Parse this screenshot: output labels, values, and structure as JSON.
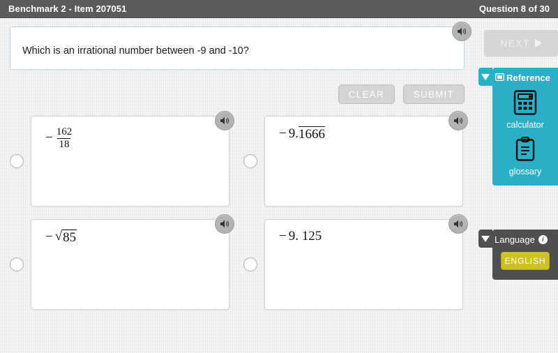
{
  "header": {
    "title": "Benchmark 2 - Item 207051",
    "question_counter": "Question 8 of 30"
  },
  "stem": {
    "text": "Which is an irrational number between -9 and -10?",
    "speaker_icon": "speaker-icon"
  },
  "actions": {
    "clear_label": "CLEAR",
    "submit_label": "SUBMIT"
  },
  "options": [
    {
      "id": "option-a",
      "kind": "fraction",
      "sign": "−",
      "numerator": "162",
      "denominator": "18",
      "speaker_icon": "speaker-icon",
      "selected": false
    },
    {
      "id": "option-b",
      "kind": "repeating-decimal",
      "sign": "−",
      "whole": "9.",
      "repeating": "1666",
      "speaker_icon": "speaker-icon",
      "selected": false
    },
    {
      "id": "option-c",
      "kind": "radical",
      "sign": "−",
      "radical_symbol": "√",
      "radicand": "85",
      "speaker_icon": "speaker-icon",
      "selected": false
    },
    {
      "id": "option-d",
      "kind": "decimal",
      "sign": "−",
      "value": "9. 125",
      "speaker_icon": "speaker-icon",
      "selected": false
    }
  ],
  "rail": {
    "next_label": "NEXT",
    "next_icon": "play-triangle-icon",
    "reference": {
      "title": "Reference",
      "header_icon": "reference-card-icon",
      "collapse_icon": "caret-down-icon",
      "tools": [
        {
          "label": "calculator",
          "icon": "calculator-icon"
        },
        {
          "label": "glossary",
          "icon": "clipboard-icon"
        }
      ]
    },
    "language": {
      "title": "Language",
      "info_icon": "info-icon",
      "info_glyph": "i",
      "collapse_icon": "caret-down-icon",
      "selected_language": "ENGLISH"
    }
  },
  "colors": {
    "header_bg": "#5b5b5b",
    "page_bg": "#ececec",
    "reference_panel": "#2aafc6",
    "language_panel": "#4f4f4f",
    "language_button": "#ccc125",
    "stem_border": "#b9dde2",
    "action_button": "#d4d4d4"
  }
}
